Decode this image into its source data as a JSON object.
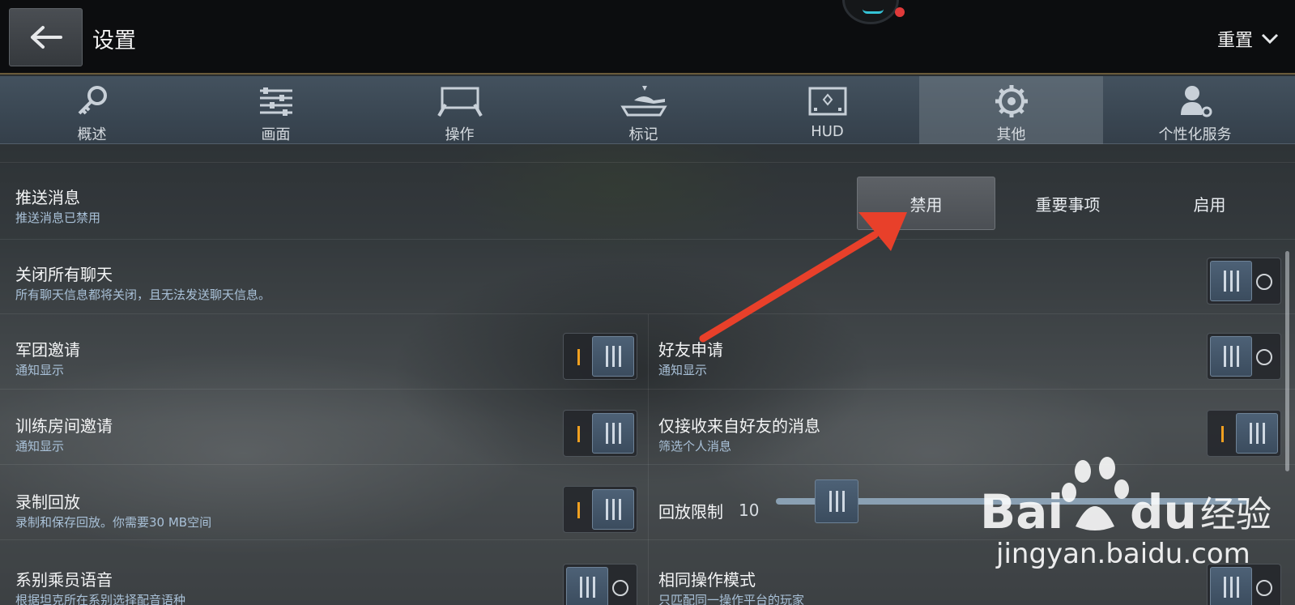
{
  "header": {
    "back_icon": "arrow-left-icon",
    "title": "设置",
    "reset_label": "重置",
    "reset_icon": "chevron-down-icon"
  },
  "tabs": [
    {
      "label": "概述",
      "icon": "key-icon"
    },
    {
      "label": "画面",
      "icon": "sliders-icon"
    },
    {
      "label": "操作",
      "icon": "controls-icon"
    },
    {
      "label": "标记",
      "icon": "tank-marker-icon"
    },
    {
      "label": "HUD",
      "icon": "hud-icon"
    },
    {
      "label": "其他",
      "icon": "gear-icon",
      "active": true
    },
    {
      "label": "个性化服务",
      "icon": "user-gear-icon"
    }
  ],
  "push": {
    "title": "推送消息",
    "subtitle": "推送消息已禁用",
    "options": [
      "禁用",
      "重要事项",
      "启用"
    ],
    "selected": "禁用"
  },
  "settings": {
    "close_chat": {
      "title": "关闭所有聊天",
      "subtitle": "所有聊天信息都将关闭，且无法发送聊天信息。",
      "on": false
    },
    "clan_invite": {
      "title": "军团邀请",
      "subtitle": "通知显示",
      "on": true
    },
    "friend_request": {
      "title": "好友申请",
      "subtitle": "通知显示",
      "on": false
    },
    "training_invite": {
      "title": "训练房间邀请",
      "subtitle": "通知显示",
      "on": true
    },
    "friends_only": {
      "title": "仅接收来自好友的消息",
      "subtitle": "筛选个人消息",
      "on": true
    },
    "record_replay": {
      "title": "录制回放",
      "subtitle": "录制和保存回放。你需要30 MB空间",
      "on": true
    },
    "replay_limit": {
      "title": "回放限制",
      "value": "10"
    },
    "crew_voice": {
      "title": "系别乘员语音",
      "subtitle": "根据坦克所在系别选择配音语种",
      "on": false
    },
    "same_platform": {
      "title": "相同操作模式",
      "subtitle": "只匹配同一操作平台的玩家",
      "on": false
    }
  },
  "watermark": {
    "logo": "Bai du 经验",
    "url": "jingyan.baidu.com"
  },
  "colors": {
    "accent_on": "#f0a020",
    "annotation_arrow": "#e8402a"
  }
}
